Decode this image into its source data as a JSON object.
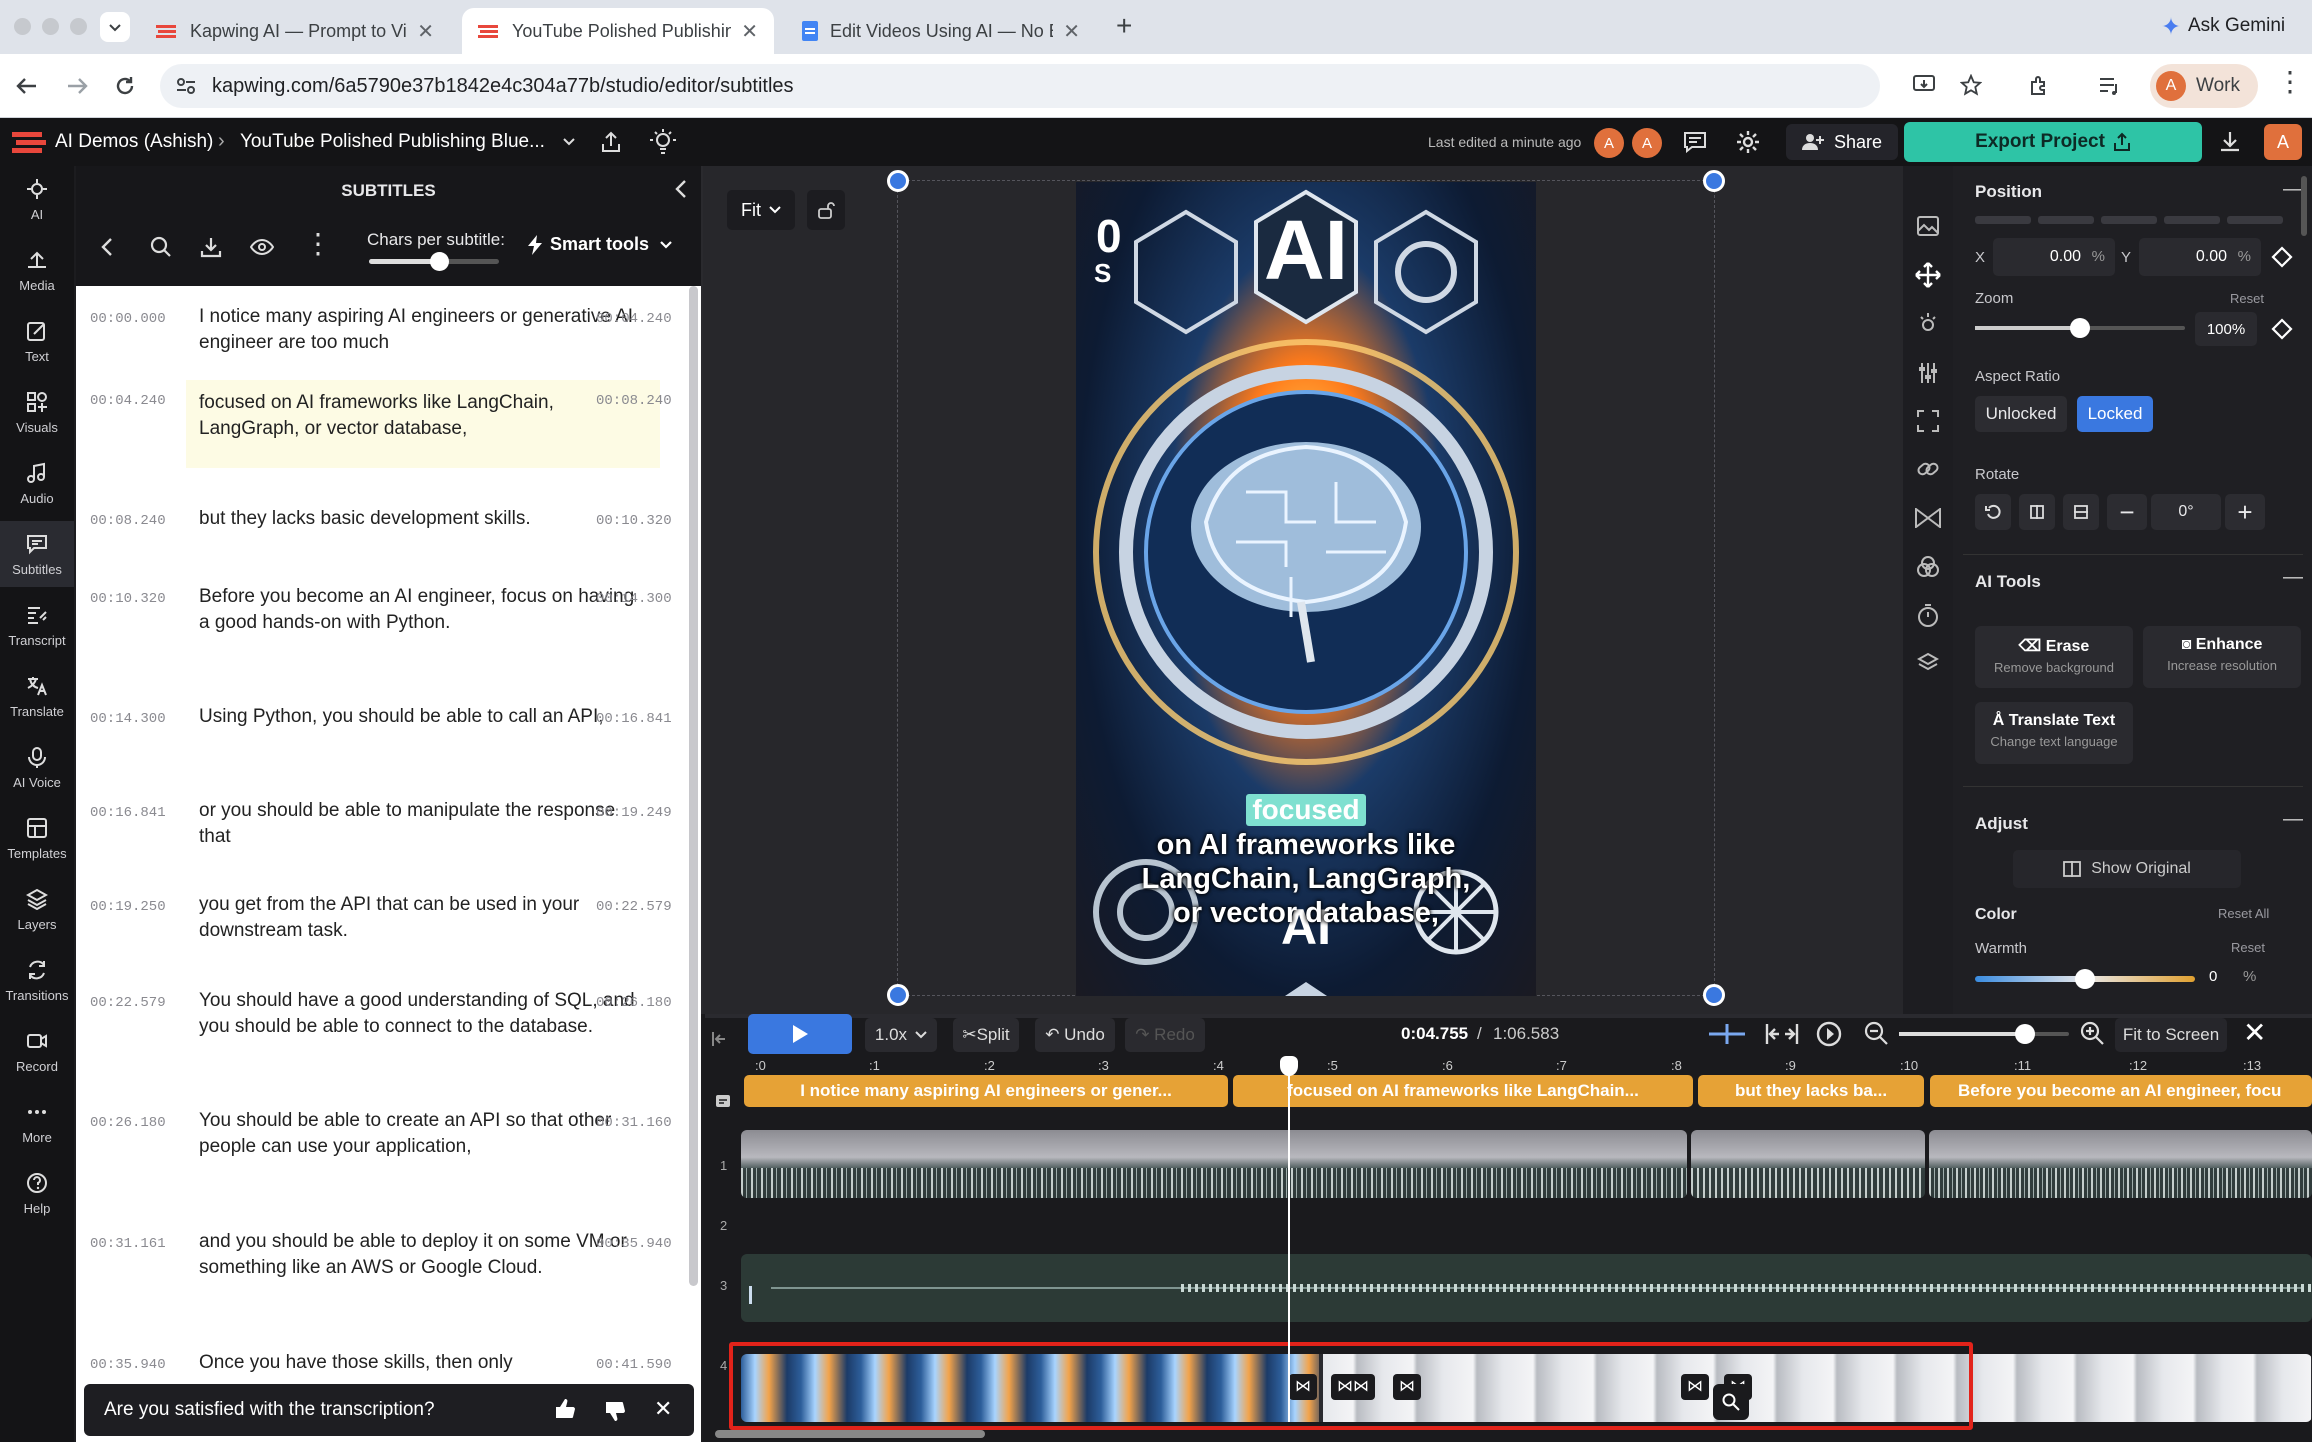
{
  "browser": {
    "tabs": [
      {
        "title": "Kapwing AI — Prompt to Vide",
        "icon": "kapwing-favicon",
        "active": false
      },
      {
        "title": "YouTube Polished Publishing",
        "icon": "kapwing-favicon",
        "active": true
      },
      {
        "title": "Edit Videos Using AI — No Ed",
        "icon": "docs-favicon",
        "active": false
      }
    ],
    "ask_gemini": "Ask Gemini",
    "url": "kapwing.com/6a5790e37b1842e4c304a77b/studio/editor/subtitles",
    "profile_label": "Work",
    "profile_initial": "A"
  },
  "app": {
    "workspace": "AI Demos (Ashish)",
    "project": "YouTube Polished Publishing Blue...",
    "last_edited": "Last edited a minute ago",
    "avatar_initial": "A",
    "share_label": "Share",
    "export_label": "Export Project",
    "accent": "#2ec4a6"
  },
  "rail": [
    {
      "label": "AI",
      "icon": "ai-sparkle-icon"
    },
    {
      "label": "Media",
      "icon": "media-icon"
    },
    {
      "label": "Text",
      "icon": "text-icon"
    },
    {
      "label": "Visuals",
      "icon": "visuals-icon"
    },
    {
      "label": "Audio",
      "icon": "audio-icon"
    },
    {
      "label": "Subtitles",
      "icon": "subtitles-icon"
    },
    {
      "label": "Transcript",
      "icon": "transcript-icon"
    },
    {
      "label": "Translate",
      "icon": "translate-icon"
    },
    {
      "label": "AI Voice",
      "icon": "ai-voice-icon"
    },
    {
      "label": "Templates",
      "icon": "templates-icon"
    },
    {
      "label": "Layers",
      "icon": "layers-icon"
    },
    {
      "label": "Transitions",
      "icon": "transitions-icon"
    },
    {
      "label": "Record",
      "icon": "record-icon"
    },
    {
      "label": "More",
      "icon": "more-icon"
    },
    {
      "label": "Help",
      "icon": "help-icon"
    }
  ],
  "subtitles": {
    "title": "SUBTITLES",
    "chars_label": "Chars per subtitle:",
    "chars_fraction": 0.54,
    "smart_tools": "Smart tools",
    "rows": [
      {
        "start": "00:00.000",
        "end": "00:04.240",
        "text": "I notice many aspiring AI engineers or generative AI engineer are too much"
      },
      {
        "start": "00:04.240",
        "end": "00:08.240",
        "text": "focused on AI frameworks like LangChain, LangGraph, or vector database,"
      },
      {
        "start": "00:08.240",
        "end": "00:10.320",
        "text": "but they lacks basic development skills."
      },
      {
        "start": "00:10.320",
        "end": "00:14.300",
        "text": "Before you become an AI engineer, focus on having a good hands-on with Python."
      },
      {
        "start": "00:14.300",
        "end": "00:16.841",
        "text": "Using Python, you should be able to call an API,"
      },
      {
        "start": "00:16.841",
        "end": "00:19.249",
        "text": "or you should be able to manipulate the response that"
      },
      {
        "start": "00:19.250",
        "end": "00:22.579",
        "text": "you get from the API that can be used in your downstream task."
      },
      {
        "start": "00:22.579",
        "end": "00:26.180",
        "text": "You should have a good understanding of SQL, and you should be able to connect to the database."
      },
      {
        "start": "00:26.180",
        "end": "00:31.160",
        "text": "You should be able to create an API so that other people can use your application,"
      },
      {
        "start": "00:31.161",
        "end": "00:35.940",
        "text": "and you should be able to deploy it on some VM or something like an AWS or Google Cloud."
      },
      {
        "start": "00:35.940",
        "end": "00:41.590",
        "text": "Once you have those skills, then only"
      }
    ],
    "feedback_question": "Are you satisfied with the transcription?"
  },
  "canvas": {
    "fit_label": "Fit",
    "preview_top_text": "AI",
    "caption_highlight": "focused",
    "caption_lines": [
      "on AI frameworks like",
      "LangChain, LangGraph,",
      "or vector database,"
    ],
    "preview_bottom_text": "AI"
  },
  "properties": {
    "position_title": "Position",
    "x_label": "X",
    "x_value": "0.00",
    "y_label": "Y",
    "y_value": "0.00",
    "unit": "%",
    "zoom_label": "Zoom",
    "zoom_reset": "Reset",
    "zoom_value": "100%",
    "zoom_fraction": 0.5,
    "aspect_title": "Aspect Ratio",
    "unlocked": "Unlocked",
    "locked": "Locked",
    "rotate_title": "Rotate",
    "rotate_value": "0°",
    "ai_tools_title": "AI Tools",
    "erase_label": "Erase",
    "erase_sub": "Remove background",
    "enhance_label": "Enhance",
    "enhance_sub": "Increase resolution",
    "translate_label": "Translate Text",
    "translate_sub": "Change text language",
    "adjust_title": "Adjust",
    "show_original": "Show Original",
    "color_title": "Color",
    "reset_all": "Reset All",
    "warmth_label": "Warmth",
    "warmth_reset": "Reset",
    "warmth_value": "0",
    "warmth_unit": "%",
    "warmth_fraction": 0.5
  },
  "timeline": {
    "speed": "1.0x",
    "split": "Split",
    "undo": "Undo",
    "redo": "Redo",
    "current_time": "0:04.755",
    "total_time": "1:06.583",
    "fit_to_screen": "Fit to Screen",
    "ruler": [
      ":0",
      ":1",
      ":2",
      ":3",
      ":4",
      ":5",
      ":6",
      ":7",
      ":8",
      ":9",
      ":10",
      ":11",
      ":12",
      ":13"
    ],
    "track_numbers": [
      "1",
      "2",
      "3",
      "4"
    ],
    "captions": [
      "I notice many aspiring AI engineers or gener...",
      "focused on AI frameworks like LangChain...",
      "but they lacks ba...",
      "Before you become an AI engineer, focu"
    ]
  }
}
